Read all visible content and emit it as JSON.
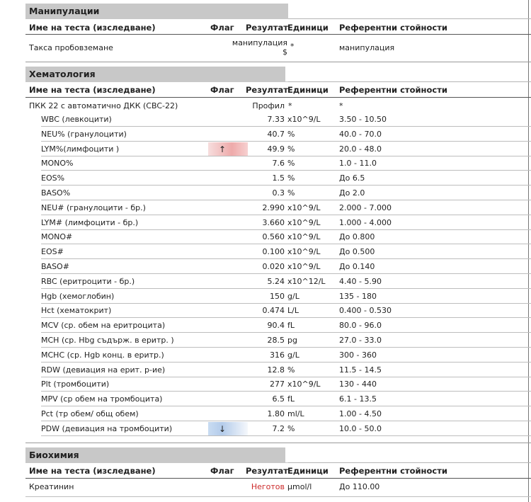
{
  "headers": {
    "test_name": "Име на теста (изследване)",
    "flag": "Флаг",
    "result": "Резултат",
    "units": "Единици",
    "reference": "Референтни стойности"
  },
  "manipulations": {
    "title": "Манипулации",
    "rows": [
      {
        "name": "Такса пробовземане",
        "result_line1": "манипулация",
        "result_line2": "$",
        "unit": "*",
        "ref": "манипулация"
      }
    ]
  },
  "hematology": {
    "title": "Хематология",
    "main": {
      "name": "ПКК 22 с автоматично ДКК (CBC-22)",
      "result": "Профил",
      "unit": "*",
      "ref": "*"
    },
    "rows": [
      {
        "name": "WBC (левкоцити)",
        "flag": "",
        "result": "7.33",
        "unit": "x10^9/L",
        "ref": "3.50 - 10.50"
      },
      {
        "name": "NEU% (гранулоцити)",
        "flag": "",
        "result": "40.7",
        "unit": "%",
        "ref": "40.0 - 70.0"
      },
      {
        "name": "LYM%(лимфоцити )",
        "flag": "↑",
        "flag_type": "up",
        "result": "49.9",
        "unit": "%",
        "ref": "20.0 - 48.0"
      },
      {
        "name": "MONO%",
        "flag": "",
        "result": "7.6",
        "unit": "%",
        "ref": "1.0 - 11.0"
      },
      {
        "name": "EOS%",
        "flag": "",
        "result": "1.5",
        "unit": "%",
        "ref": "До 6.5"
      },
      {
        "name": "BASO%",
        "flag": "",
        "result": "0.3",
        "unit": "%",
        "ref": "До 2.0"
      },
      {
        "name": "NEU# (гранулоцити - бр.)",
        "flag": "",
        "result": "2.990",
        "unit": "x10^9/L",
        "ref": "2.000 - 7.000"
      },
      {
        "name": "LYM# (лимфоцити - бр.)",
        "flag": "",
        "result": "3.660",
        "unit": "x10^9/L",
        "ref": "1.000 - 4.000"
      },
      {
        "name": "MONO#",
        "flag": "",
        "result": "0.560",
        "unit": "x10^9/L",
        "ref": "До 0.800"
      },
      {
        "name": "EOS#",
        "flag": "",
        "result": "0.100",
        "unit": "x10^9/L",
        "ref": "До 0.500"
      },
      {
        "name": "BASO#",
        "flag": "",
        "result": "0.020",
        "unit": "x10^9/L",
        "ref": "До 0.140"
      },
      {
        "name": "RBC (еритроцити - бр.)",
        "flag": "",
        "result": "5.24",
        "unit": "x10^12/L",
        "ref": "4.40 - 5.90"
      },
      {
        "name": "Hgb (хемоглобин)",
        "flag": "",
        "result": "150",
        "unit": "g/L",
        "ref": "135 - 180"
      },
      {
        "name": "Hct (хематокрит)",
        "flag": "",
        "result": "0.474",
        "unit": "L/L",
        "ref": "0.400 - 0.530"
      },
      {
        "name": "MCV (ср. обем на еритроцита)",
        "flag": "",
        "result": "90.4",
        "unit": "fL",
        "ref": "80.0 - 96.0"
      },
      {
        "name": "MCH (ср. Hbg съдърж. в еритр. )",
        "flag": "",
        "result": "28.5",
        "unit": "pg",
        "ref": "27.0 - 33.0"
      },
      {
        "name": "MCHC (ср. Hgb конц. в еритр.)",
        "flag": "",
        "result": "316",
        "unit": "g/L",
        "ref": "300 - 360"
      },
      {
        "name": "RDW (девиация на ерит. р-ие)",
        "flag": "",
        "result": "12.8",
        "unit": "%",
        "ref": "11.5 - 14.5"
      },
      {
        "name": "Plt (тромбоцити)",
        "flag": "",
        "result": "277",
        "unit": "x10^9/L",
        "ref": "130 - 440"
      },
      {
        "name": "MPV (ср обем на тромбоцита)",
        "flag": "",
        "result": "6.5",
        "unit": "fL",
        "ref": "6.1 - 13.5"
      },
      {
        "name": "Pct (тр обем/ общ обем)",
        "flag": "",
        "result": "1.80",
        "unit": "ml/L",
        "ref": "1.00 - 4.50"
      },
      {
        "name": "PDW (девиация на тромбоцити)",
        "flag": "↓",
        "flag_type": "down",
        "result": "7.2",
        "unit": "%",
        "ref": "10.0 - 50.0"
      }
    ]
  },
  "biochemistry": {
    "title": "Биохимия",
    "rows": [
      {
        "name": "Креатинин",
        "result": "Неготов",
        "result_color": "#cc2a2a",
        "unit": "μmol/l",
        "ref": "До 110.00"
      }
    ]
  },
  "colors": {
    "section_bg": "#c8c8c8",
    "flag_high": "#eeaaaa",
    "flag_low": "#b3cbea",
    "pending_text": "#cc2a2a"
  }
}
